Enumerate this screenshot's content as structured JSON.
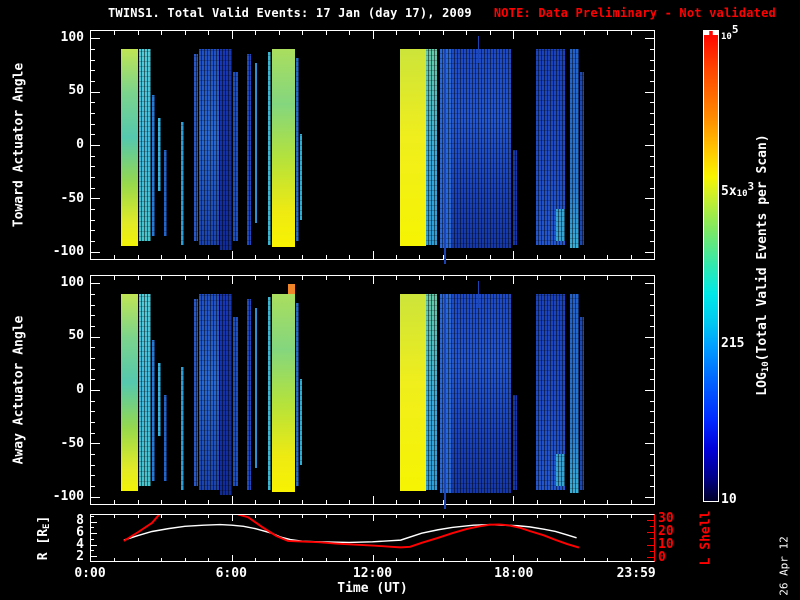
{
  "title": {
    "main": "TWINS1. Total Valid Events: 17 Jan (day  17), 2009",
    "note": "NOTE: Data Preliminary - Not validated",
    "note_color": "#ff0000"
  },
  "colors": {
    "background": "#000000",
    "frame": "#ffffff",
    "r_line": "#ffffff",
    "l_shell": "#ff0000"
  },
  "watermark": "26 Apr 12",
  "chart_data": {
    "type": "heatmap",
    "description": "Two time-vs-actuator-angle spectrogram panels of total valid events, an orbit line panel (R and L Shell vs time), and a log rainbow colorbar",
    "time_axis": {
      "label": "Time (UT)",
      "range_hours": [
        0,
        24
      ],
      "tick_labels": [
        [
          0,
          "0:00"
        ],
        [
          6,
          "6:00"
        ],
        [
          12,
          "12:00"
        ],
        [
          18,
          "18:00"
        ],
        [
          23.2,
          "23:59"
        ]
      ],
      "minor_tick_every_hours": 1,
      "major_tick_every_hours": 6
    },
    "spectrograms": [
      {
        "name": "toward",
        "ylabel": "Toward Actuator Angle",
        "yticks": [
          100,
          50,
          0,
          -50,
          -100
        ],
        "yrange": [
          -107,
          107
        ],
        "extra_stripes": []
      },
      {
        "name": "away",
        "ylabel": "Away Actuator Angle",
        "yticks": [
          100,
          50,
          0,
          -50,
          -100
        ],
        "yrange": [
          -107,
          107
        ],
        "extra_stripes": [
          {
            "x": 35.04,
            "w": 1.24,
            "top": 3.5,
            "h": 4.2,
            "c": "#f08428"
          }
        ]
      }
    ],
    "stripes_shared": [
      {
        "x": 5.31,
        "w": 3.01,
        "top": 7.8,
        "h": 86.5,
        "c": [
          [
            0,
            "#c0e455"
          ],
          [
            22,
            "#7cd48c"
          ],
          [
            45,
            "#55c8ae"
          ],
          [
            68,
            "#96d84e"
          ],
          [
            88,
            "#e0ea28"
          ],
          [
            100,
            "#f2f207"
          ]
        ]
      },
      {
        "x": 8.5,
        "w": 2.12,
        "top": 8,
        "h": 84,
        "c": [
          [
            0,
            "#55ccd8"
          ],
          [
            50,
            "#3fb8dc"
          ],
          [
            100,
            "#48c4cc"
          ]
        ],
        "sp": true
      },
      {
        "x": 10.8,
        "w": 0.53,
        "top": 28,
        "h": 62,
        "c": "#2878d8",
        "sp": true
      },
      {
        "x": 11.86,
        "w": 0.53,
        "top": 38,
        "h": 32,
        "c": "#38b4e0",
        "sp": true
      },
      {
        "x": 12.92,
        "w": 0.53,
        "top": 52,
        "h": 38,
        "c": "#2264cc",
        "sp": true
      },
      {
        "x": 15.93,
        "w": 0.53,
        "top": 40,
        "h": 54,
        "c": "#2e9ed8",
        "sp": true
      },
      {
        "x": 18.23,
        "w": 0.71,
        "top": 10,
        "h": 82,
        "c": "#2757c8",
        "sp": true
      },
      {
        "x": 19.12,
        "w": 3.54,
        "top": 8,
        "h": 86,
        "c": [
          [
            0,
            "#2050c4"
          ],
          [
            45,
            "#2868d2"
          ],
          [
            100,
            "#1a42ac"
          ]
        ],
        "sp": true
      },
      {
        "x": 22.83,
        "w": 2.3,
        "top": 8,
        "h": 88,
        "c": [
          [
            0,
            "#1838b4"
          ],
          [
            100,
            "#122c96"
          ]
        ],
        "sp": true
      },
      {
        "x": 25.31,
        "w": 0.88,
        "top": 18,
        "h": 74,
        "c": "#2050bc",
        "sp": true
      },
      {
        "x": 27.79,
        "w": 0.71,
        "top": 10,
        "h": 84,
        "c": "#2148bc",
        "sp": true
      },
      {
        "x": 29.2,
        "w": 0.35,
        "top": 14,
        "h": 70,
        "c": "#2a90d2"
      },
      {
        "x": 31.5,
        "w": 0.53,
        "top": 9,
        "h": 85,
        "c": "#3ab6d2",
        "sp": true
      },
      {
        "x": 32.21,
        "w": 4.07,
        "top": 7.8,
        "h": 87,
        "c": [
          [
            0,
            "#aade5e"
          ],
          [
            28,
            "#84d67e"
          ],
          [
            55,
            "#b4e23c"
          ],
          [
            82,
            "#eeea12"
          ],
          [
            100,
            "#f8f202"
          ]
        ]
      },
      {
        "x": 36.46,
        "w": 0.53,
        "top": 12,
        "h": 80,
        "c": "#2868c8",
        "sp": true
      },
      {
        "x": 37.17,
        "w": 0.35,
        "top": 45,
        "h": 38,
        "c": "#30aed2",
        "sp": true
      },
      {
        "x": 54.87,
        "w": 4.6,
        "top": 7.8,
        "h": 86.5,
        "c": [
          [
            0,
            "#cce43a"
          ],
          [
            45,
            "#f0ee1c"
          ],
          [
            100,
            "#f6f402"
          ]
        ]
      },
      {
        "x": 59.47,
        "w": 1.95,
        "top": 8,
        "h": 86,
        "c": [
          [
            0,
            "#66ccaa"
          ],
          [
            55,
            "#38aadd"
          ],
          [
            100,
            "#2d9ed8"
          ]
        ],
        "sp": true
      },
      {
        "x": 61.95,
        "w": 2.12,
        "top": 8,
        "h": 87,
        "c": "#2968d8",
        "sp": true
      },
      {
        "x": 62.7,
        "w": 0.3,
        "top": 8,
        "h": 94,
        "c": "#1a44b4"
      },
      {
        "x": 64.07,
        "w": 10.62,
        "top": 8,
        "h": 87,
        "c": [
          [
            0,
            "#1d4ac4"
          ],
          [
            35,
            "#2257d0"
          ],
          [
            70,
            "#1a44bb"
          ],
          [
            100,
            "#1538a6"
          ]
        ],
        "sp": true
      },
      {
        "x": 68.7,
        "w": 0.3,
        "top": 2,
        "h": 12,
        "c": "#1a44b4"
      },
      {
        "x": 74.87,
        "w": 0.71,
        "top": 52,
        "h": 42,
        "c": "#1838a8",
        "sp": true
      },
      {
        "x": 79.12,
        "w": 5.13,
        "top": 8,
        "h": 86,
        "c": [
          [
            0,
            "#1942bb"
          ],
          [
            55,
            "#1f4cc6"
          ],
          [
            100,
            "#2356cc"
          ]
        ],
        "sp": true
      },
      {
        "x": 82.65,
        "w": 1.59,
        "top": 78,
        "h": 14,
        "c": "#34a4d4",
        "sp": true
      },
      {
        "x": 85.13,
        "w": 1.59,
        "top": 8,
        "h": 87,
        "c": [
          [
            0,
            "#2260cc"
          ],
          [
            70,
            "#2a7ad0"
          ],
          [
            100,
            "#38b0d8"
          ]
        ],
        "sp": true
      },
      {
        "x": 86.9,
        "w": 0.71,
        "top": 18,
        "h": 76,
        "c": "#1d48b4",
        "sp": true
      }
    ],
    "orbit_panel": {
      "left_axis": {
        "label_pre": "R [R",
        "label_sub": "E",
        "label_post": "]",
        "ticks": [
          8,
          6,
          4,
          2
        ],
        "range": [
          1.17,
          9.17
        ],
        "color": "#ffffff"
      },
      "right_axis": {
        "label": "L Shell",
        "ticks": [
          30,
          20,
          10,
          0
        ],
        "range": [
          -3.1,
          33.8
        ],
        "color": "#ff0000"
      },
      "r_series": [
        [
          1.4,
          4.8
        ],
        [
          2.0,
          5.6
        ],
        [
          2.6,
          6.3
        ],
        [
          3.3,
          6.8
        ],
        [
          4.0,
          7.2
        ],
        [
          4.8,
          7.4
        ],
        [
          5.5,
          7.5
        ],
        [
          6.0,
          7.4
        ],
        [
          6.5,
          7.2
        ],
        [
          7.0,
          6.8
        ],
        [
          7.7,
          6.0
        ],
        [
          8.1,
          5.3
        ],
        [
          8.5,
          4.9
        ],
        [
          9.0,
          4.6
        ],
        [
          9.7,
          4.5
        ],
        [
          11.0,
          4.4
        ],
        [
          12.0,
          4.5
        ],
        [
          12.8,
          4.7
        ],
        [
          13.2,
          4.8
        ],
        [
          14.1,
          6.0
        ],
        [
          14.8,
          6.6
        ],
        [
          15.4,
          7.0
        ],
        [
          16.3,
          7.4
        ],
        [
          17.0,
          7.5
        ],
        [
          17.5,
          7.4
        ],
        [
          18.2,
          7.3
        ],
        [
          18.7,
          7.1
        ],
        [
          19.3,
          6.7
        ],
        [
          19.8,
          6.3
        ],
        [
          20.3,
          5.7
        ],
        [
          20.7,
          5.2
        ]
      ],
      "l_series": [
        [
          1.4,
          13.0
        ],
        [
          2.0,
          20.0
        ],
        [
          2.6,
          27.5
        ],
        [
          2.9,
          34.0
        ],
        [
          3.1,
          42.0
        ],
        [
          5.9,
          42.0
        ],
        [
          6.3,
          34.0
        ],
        [
          6.7,
          32.0
        ],
        [
          7.3,
          24.0
        ],
        [
          7.9,
          17.0
        ],
        [
          8.4,
          13.0
        ],
        [
          9.0,
          12.5
        ],
        [
          9.7,
          12.0
        ],
        [
          10.5,
          10.8
        ],
        [
          11.3,
          10.0
        ],
        [
          12.1,
          9.2
        ],
        [
          12.8,
          8.3
        ],
        [
          13.2,
          7.8
        ],
        [
          13.6,
          8.3
        ],
        [
          14.1,
          11.5
        ],
        [
          14.8,
          15.5
        ],
        [
          15.4,
          19.2
        ],
        [
          16.0,
          22.5
        ],
        [
          16.5,
          24.5
        ],
        [
          17.0,
          26.0
        ],
        [
          17.4,
          26.2
        ],
        [
          17.8,
          25.5
        ],
        [
          18.3,
          23.5
        ],
        [
          18.7,
          21.0
        ],
        [
          19.3,
          17.5
        ],
        [
          19.8,
          13.8
        ],
        [
          20.3,
          10.5
        ],
        [
          20.8,
          7.7
        ]
      ]
    },
    "colorbar": {
      "label_pre": "LOG",
      "label_sub": "10",
      "label_post": "(Total Valid Events per Scan)",
      "scale": "log10 from 10 to 1e5",
      "gradient": [
        [
          0,
          "#ff0000"
        ],
        [
          8,
          "#ff4400"
        ],
        [
          18,
          "#ff8800"
        ],
        [
          26,
          "#ffcc00"
        ],
        [
          31,
          "#f8f400"
        ],
        [
          34,
          "#d8f020"
        ],
        [
          42,
          "#80e860"
        ],
        [
          50,
          "#30e8b0"
        ],
        [
          56,
          "#00e8e8"
        ],
        [
          62,
          "#00c8f0"
        ],
        [
          67,
          "#00a0ff"
        ],
        [
          75,
          "#0060ff"
        ],
        [
          83,
          "#0028ff"
        ],
        [
          89,
          "#0000d8"
        ],
        [
          95,
          "#000088"
        ],
        [
          100,
          "#000028"
        ]
      ],
      "ticks": [
        {
          "pos": 0,
          "pre": "",
          "base": "10",
          "sup": "5",
          "dash": false
        },
        {
          "pos": 33.4,
          "pre": "5x",
          "base": "10",
          "sup": "3",
          "dash": true
        },
        {
          "pos": 66.8,
          "pre": "215",
          "base": "",
          "sup": "",
          "dash": true
        },
        {
          "pos": 100,
          "pre": "10",
          "base": "",
          "sup": "",
          "dash": false
        }
      ]
    }
  }
}
